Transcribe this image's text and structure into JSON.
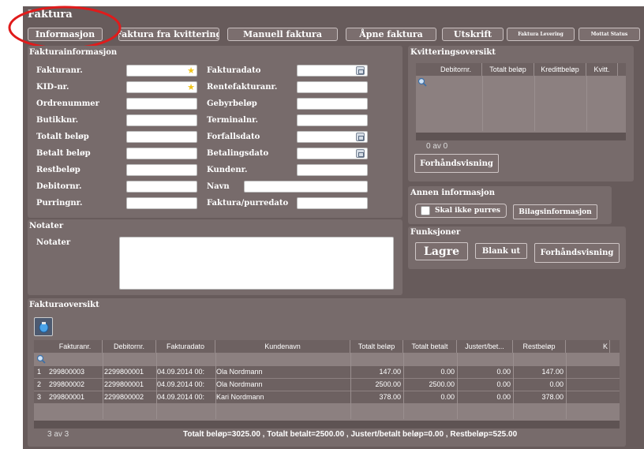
{
  "window": {
    "title": "Faktura"
  },
  "toolbar": {
    "buttons": [
      {
        "label": "Informasjon"
      },
      {
        "label": "Faktura fra kvittering"
      },
      {
        "label": "Manuell faktura"
      },
      {
        "label": "Åpne faktura"
      },
      {
        "label": "Utskrift"
      },
      {
        "label": "Faktura Levering"
      },
      {
        "label": "Mottat Status"
      }
    ]
  },
  "fakturainfo": {
    "title": "Fakturainformasjon",
    "left_fields": [
      {
        "label": "Fakturanr.",
        "value": ""
      },
      {
        "label": "KID-nr.",
        "value": ""
      },
      {
        "label": "Ordrenummer",
        "value": ""
      },
      {
        "label": "Butikknr.",
        "value": ""
      },
      {
        "label": "Totalt beløp",
        "value": ""
      },
      {
        "label": "Betalt beløp",
        "value": ""
      },
      {
        "label": "Restbeløp",
        "value": ""
      },
      {
        "label": "Debitornr.",
        "value": ""
      },
      {
        "label": "Purringnr.",
        "value": ""
      }
    ],
    "right_fields": [
      {
        "label": "Fakturadato",
        "value": ""
      },
      {
        "label": "Rentefakturanr.",
        "value": ""
      },
      {
        "label": "Gebyrbeløp",
        "value": ""
      },
      {
        "label": "Terminalnr.",
        "value": ""
      },
      {
        "label": "Forfallsdato",
        "value": ""
      },
      {
        "label": "Betalingsdato",
        "value": ""
      },
      {
        "label": "Kundenr.",
        "value": ""
      },
      {
        "label": "Navn",
        "value": ""
      },
      {
        "label": "Faktura/purredato",
        "value": ""
      }
    ]
  },
  "notater": {
    "title": "Notater",
    "label": "Notater",
    "value": ""
  },
  "kvittering": {
    "title": "Kvitteringsoversikt",
    "columns": [
      "Debitornr.",
      "Totalt beløp",
      "Kredittbeløp",
      "Kvitt."
    ],
    "count_text": "0 av 0",
    "preview_label": "Forhåndsvisning"
  },
  "annen": {
    "title": "Annen informasjon",
    "checkbox_label": "Skal ikke purres",
    "checkbox_checked": false,
    "bilag_label": "Bilagsinformasjon"
  },
  "funksjoner": {
    "title": "Funksjoner",
    "lagre_label": "Lagre",
    "blank_label": "Blank ut",
    "preview_label": "Forhåndsvisning"
  },
  "fakturaoversikt": {
    "title": "Fakturaoversikt",
    "columns": [
      "Fakturanr.",
      "Debitornr.",
      "Fakturadato",
      "Kundenavn",
      "Totalt beløp",
      "Totalt betalt",
      "Justert/bet...",
      "Restbeløp",
      "K"
    ],
    "rows": [
      {
        "n": "1",
        "cells": [
          "299800003",
          "2299800001",
          "04.09.2014 00:",
          "Ola Nordmann",
          "147.00",
          "0.00",
          "0.00",
          "147.00"
        ]
      },
      {
        "n": "2",
        "cells": [
          "299800002",
          "2299800001",
          "04.09.2014 00:",
          "Ola Nordmann",
          "2500.00",
          "2500.00",
          "0.00",
          "0.00"
        ]
      },
      {
        "n": "3",
        "cells": [
          "299800001",
          "2299800002",
          "04.09.2014 00:",
          "Kari Nordmann",
          "378.00",
          "0.00",
          "0.00",
          "378.00"
        ]
      }
    ],
    "count_text": "3 av 3",
    "summary": "Totalt beløp=3025.00 , Totalt betalt=2500.00 , Justert/betalt beløp=0.00 , Restbeløp=525.00"
  },
  "colors": {
    "background": "#675b5b",
    "panel": "#776b6b",
    "annotation_red": "#e01b1b"
  }
}
